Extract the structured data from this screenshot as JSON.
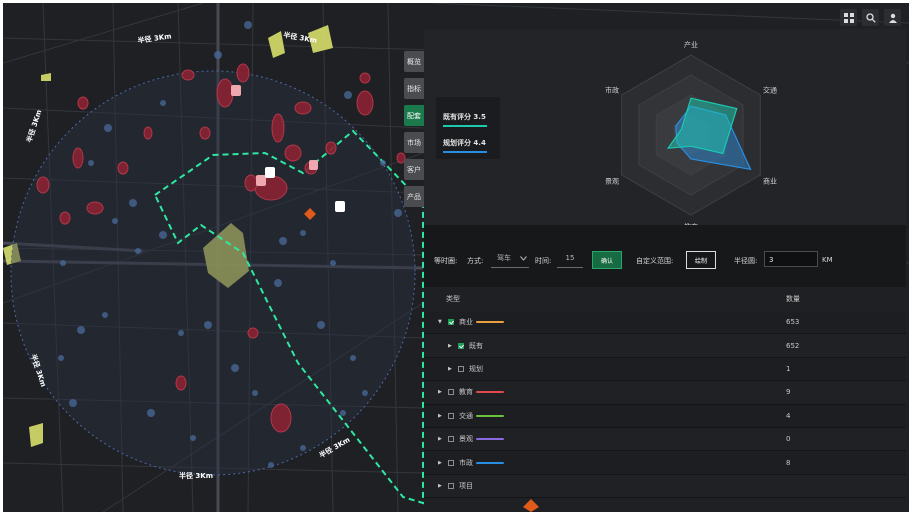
{
  "toolbar": {
    "icons": [
      "grid-icon",
      "search-icon",
      "user-icon"
    ]
  },
  "side_tabs": [
    {
      "label": "概览",
      "active": false
    },
    {
      "label": "指标",
      "active": false
    },
    {
      "label": "配套",
      "active": true
    },
    {
      "label": "市场",
      "active": false
    },
    {
      "label": "客户",
      "active": false
    },
    {
      "label": "产品",
      "active": false
    }
  ],
  "map": {
    "radius_labels": [
      "半径 3Km",
      "半径 3Km",
      "半径 3Km",
      "半径 3Km",
      "半径 3Km",
      "半径 3Km"
    ]
  },
  "radar": {
    "axes": [
      "产业",
      "交通",
      "商业",
      "教育",
      "景观",
      "市政"
    ],
    "existing_score_label": "既有评分 3.5",
    "planned_score_label": "规划评分 4.4",
    "existing_values": [
      0.46,
      0.66,
      0.46,
      0.14,
      0.33,
      0.14
    ],
    "planned_values": [
      0.36,
      0.5,
      0.86,
      0.3,
      0.2,
      0.22
    ],
    "existing_color": "#1ccab0",
    "planned_color": "#2a8ee0"
  },
  "controls": {
    "isochrone_label": "等时圈:",
    "mode_label": "方式:",
    "mode_value": "驾车",
    "time_label": "时间:",
    "time_value": "15",
    "confirm_label": "确认",
    "custom_range_label": "自定义范围:",
    "draw_label": "绘制",
    "radius_label": "半径圆:",
    "radius_value": "3",
    "radius_unit": "KM"
  },
  "table": {
    "headers": {
      "type": "类型",
      "count": "数量"
    },
    "rows": [
      {
        "label": "商业",
        "count": "653",
        "level": 0,
        "checked": true,
        "expanded": true,
        "color": "#e8a040"
      },
      {
        "label": "既有",
        "count": "652",
        "level": 1,
        "checked": true,
        "expanded": false,
        "color": ""
      },
      {
        "label": "规划",
        "count": "1",
        "level": 1,
        "checked": false,
        "expanded": false,
        "color": ""
      },
      {
        "label": "教育",
        "count": "9",
        "level": 0,
        "checked": false,
        "expanded": false,
        "color": "#e04a4a"
      },
      {
        "label": "交通",
        "count": "4",
        "level": 0,
        "checked": false,
        "expanded": false,
        "color": "#6cc040"
      },
      {
        "label": "景观",
        "count": "0",
        "level": 0,
        "checked": false,
        "expanded": false,
        "color": "#8a6ae0"
      },
      {
        "label": "市政",
        "count": "8",
        "level": 0,
        "checked": false,
        "expanded": false,
        "color": "#2a8ee0"
      },
      {
        "label": "项目",
        "count": "",
        "level": 0,
        "checked": false,
        "expanded": false,
        "color": ""
      }
    ]
  }
}
